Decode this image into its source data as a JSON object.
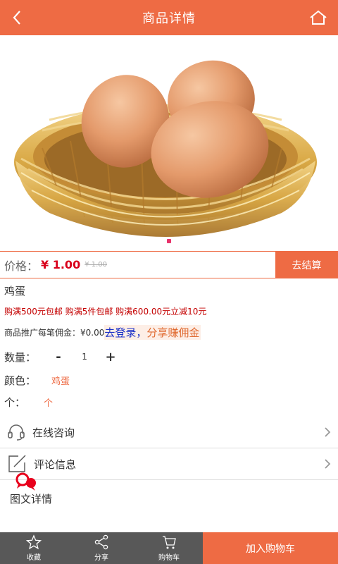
{
  "header": {
    "title": "商品详情",
    "back_icon": "chevron-left-icon",
    "home_icon": "home-icon"
  },
  "product": {
    "image_alt": "eggs-in-basket",
    "price_label": "价格：",
    "price": "¥ 1.00",
    "original_price": "¥ 1.00",
    "checkout_label": "去结算",
    "name": "鸡蛋",
    "promotions": "购满500元包邮 购满5件包邮 购满600.00元立减10元",
    "commission_label": "商品推广每笔佣金：¥0.00",
    "commission_link": "去登录，",
    "commission_sub": "分享赚佣金"
  },
  "options": {
    "quantity_label": "数量：",
    "minus": "-",
    "quantity": "1",
    "plus": "+",
    "color_label": "颜色：",
    "color_value": "鸡蛋",
    "unit_label": "个：",
    "unit_value": "个"
  },
  "list": {
    "consult": "在线咨询",
    "review": "评论信息",
    "detail": "图文详情"
  },
  "bottom_bar": {
    "favorite": "收藏",
    "share": "分享",
    "cart": "购物车",
    "add_to_cart": "加入购物车"
  },
  "colors": {
    "accent": "#ee6b44",
    "price": "#d9001b",
    "bar": "#585858"
  }
}
